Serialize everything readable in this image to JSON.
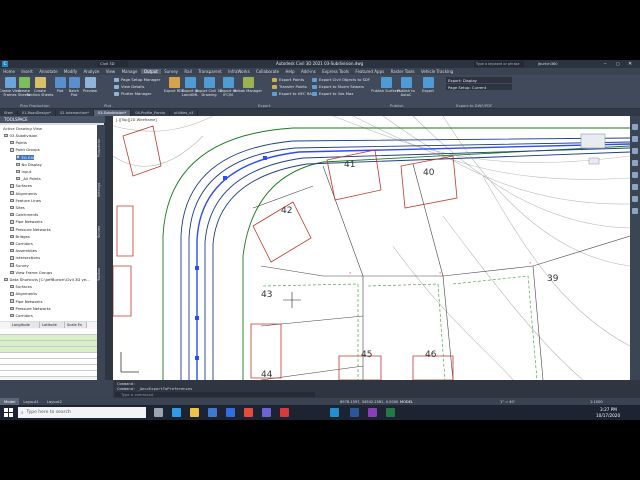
{
  "window": {
    "title": "Autodesk Civil 3D 2021   03-Subdivision.dwg",
    "qat_field": "Civil 3D",
    "search_placeholder": "Type a keyword or phrase",
    "user": "jburtch360"
  },
  "menu": [
    "Home",
    "Insert",
    "Annotate",
    "Modify",
    "Analyze",
    "View",
    "Manage",
    "Output",
    "Survey",
    "Rail",
    "Transparent",
    "InfraWorks",
    "Collaborate",
    "Help",
    "Add-ins",
    "Express Tools",
    "Featured Apps",
    "Raster Tools",
    "Vehicle Tracking"
  ],
  "menu_active": "Output",
  "ribbon": {
    "buttons": [
      {
        "name": "create-view-frames-button",
        "label": "Create View\nFrames",
        "color": "#6aa6dc"
      },
      {
        "name": "create-sheets-button",
        "label": "Create\nSheets",
        "color": "#7cbf5a"
      },
      {
        "name": "create-section-sheets-button",
        "label": "Create\nSection Sheets",
        "color": "#d8c067"
      },
      {
        "name": "plot-button",
        "label": "Plot",
        "color": "#5a8fcf"
      },
      {
        "name": "batch-plot-button",
        "label": "Batch\nPlot",
        "color": "#5a8fcf"
      },
      {
        "name": "preview-button",
        "label": "Preview",
        "color": "#8fb3d9"
      },
      {
        "name": "export-rds-button",
        "label": "Export RDS",
        "color": "#d8a24a"
      },
      {
        "name": "export-landxml-button",
        "label": "Export to\nLandXML",
        "color": "#4f9bd6"
      },
      {
        "name": "export-civil3d-drawing-button",
        "label": "Export Civil 3D\nDrawing",
        "color": "#4f9bd6"
      },
      {
        "name": "export-ifc-button",
        "label": "Export to\nIFC/N",
        "color": "#4f9bd6"
      },
      {
        "name": "rebak-manager-button",
        "label": "Rebak Manager",
        "color": "#9ab34d"
      },
      {
        "name": "publish-surfaces-button",
        "label": "Publish Surfaces",
        "color": "#4f9bd6"
      },
      {
        "name": "publish-autocad-button",
        "label": "Publish to\nAutoC",
        "color": "#4f9bd6"
      },
      {
        "name": "export-button",
        "label": "Export",
        "color": "#4f9bd6"
      }
    ],
    "small_left": [
      "Page Setup Manager",
      "View Details",
      "Plotter Manager"
    ],
    "small_mid": [
      "Export Points",
      "Transfer Points",
      "Export to HEC RAS",
      "Export Civil Objects to SDF",
      "Export to Storm Sewers",
      "Export to 3ds Max"
    ],
    "export_dropdowns": [
      "Export: Display",
      "Page Setup: Current"
    ],
    "export_pdf": "Export to DWF/PDF",
    "panels": {
      "plan_production": "Plan Production",
      "plot": "Plot",
      "export": "Export",
      "publish": "Publish"
    }
  },
  "doc_tabs": [
    "Start",
    "01-RoadDesign*",
    "02-Intersection*",
    "03-Subdivision*",
    "04-Profile_Pondo",
    "utilities_v3"
  ],
  "doc_tab_active": "03-Subdivision*",
  "viewport_label": "[-][Top][2D Wireframe]",
  "toolspace": {
    "title": "TOOLSPACE",
    "filter": "Active Drawing View",
    "tree": [
      {
        "label": "03-Subdivision",
        "level": 0
      },
      {
        "label": "Points",
        "level": 1
      },
      {
        "label": "Point Groups",
        "level": 1
      },
      {
        "label": "EG EXI",
        "level": 2,
        "selected": true
      },
      {
        "label": "No Display",
        "level": 2
      },
      {
        "label": "Input",
        "level": 2
      },
      {
        "label": "_All Points",
        "level": 2
      },
      {
        "label": "Surfaces",
        "level": 1
      },
      {
        "label": "Alignments",
        "level": 1
      },
      {
        "label": "Feature Lines",
        "level": 1
      },
      {
        "label": "Sites",
        "level": 1
      },
      {
        "label": "Catchments",
        "level": 1
      },
      {
        "label": "Pipe Networks",
        "level": 1
      },
      {
        "label": "Pressure Networks",
        "level": 1
      },
      {
        "label": "Bridges",
        "level": 1
      },
      {
        "label": "Corridors",
        "level": 1
      },
      {
        "label": "Assemblies",
        "level": 1
      },
      {
        "label": "Intersections",
        "level": 1
      },
      {
        "label": "Survey",
        "level": 1
      },
      {
        "label": "View Frame Groups",
        "level": 1
      },
      {
        "label": "Data Shortcuts [C:\\JeffBurtch\\Civil 3D ye...",
        "level": 0
      },
      {
        "label": "Surfaces",
        "level": 1
      },
      {
        "label": "Alignments",
        "level": 1
      },
      {
        "label": "Pipe Networks",
        "level": 1
      },
      {
        "label": "Pressure Networks",
        "level": 1
      },
      {
        "label": "Corridors",
        "level": 1
      }
    ],
    "side_tabs": [
      "Prospector",
      "Settings",
      "Survey",
      "Toolbox"
    ],
    "grid_headers": [
      "Longitude",
      "Latitude",
      "Scale Fa"
    ]
  },
  "parcels": [
    "41",
    "40",
    "42",
    "43",
    "39",
    "45",
    "46",
    "44"
  ],
  "command": {
    "line1": "Command:",
    "line2": "Command:  _AeccExportToPreferences",
    "input_placeholder": "Type a command"
  },
  "status": {
    "coords": "6978.1597, 34942.2581, 0.0000",
    "model": "MODEL",
    "scale": "1\" = 40'",
    "layouts": [
      "Model",
      "Layout1",
      "Layout2"
    ],
    "layout_active": "Model",
    "zoom": "1:1000"
  },
  "taskbar": {
    "search_placeholder": "Type here to search",
    "time": "3:27 PM",
    "date": "10/17/2020"
  }
}
